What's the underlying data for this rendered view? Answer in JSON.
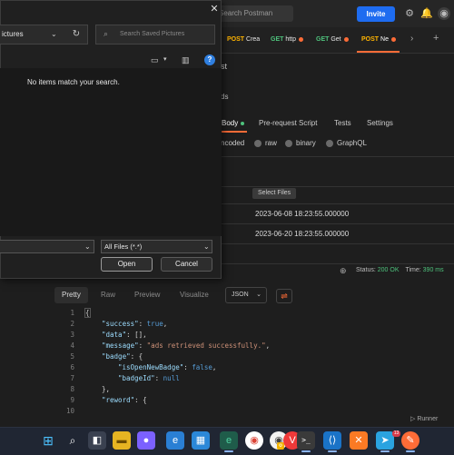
{
  "postman": {
    "search_placeholder": "Search Postman",
    "invite_label": "Invite",
    "tabs": [
      {
        "method": "POST",
        "name": "Crea"
      },
      {
        "method": "GET",
        "name": "http"
      },
      {
        "method": "GET",
        "name": "Get"
      },
      {
        "method": "POST",
        "name": "Ne"
      }
    ],
    "request_title_fragment": "st",
    "section_fragment": "ds",
    "subtabs": [
      "Body",
      "Pre-request Script",
      "Tests",
      "Settings"
    ],
    "body_types": [
      "ncoded",
      "raw",
      "binary",
      "GraphQL"
    ],
    "select_files_label": "Select Files",
    "dates": [
      "2023-06-08 18:23:55.000000",
      "2023-06-20 18:23:55.000000"
    ],
    "status_label": "Status:",
    "status_value": "200 OK",
    "time_label": "Time:",
    "time_value": "390 ms",
    "response_tabs": [
      "Pretty",
      "Raw",
      "Preview",
      "Visualize"
    ],
    "format_select": "JSON",
    "runner_label": "Runner",
    "code_line_numbers": [
      "1",
      "2",
      "3",
      "4",
      "5",
      "6",
      "7",
      "8",
      "9",
      "10"
    ],
    "code_lines": {
      "l1": "{",
      "l2_key": "\"success\"",
      "l2_rest": ": ",
      "l2_val": "true",
      "l2_end": ",",
      "l3_key": "\"data\"",
      "l3_rest": ": [],",
      "l4_key": "\"message\"",
      "l4_rest": ": ",
      "l4_val": "\"ads retrieved successfully.\"",
      "l4_end": ",",
      "l5_key": "\"badge\"",
      "l5_rest": ": {",
      "l6_key": "\"isOpenNewBadge\"",
      "l6_rest": ": ",
      "l6_val": "false",
      "l6_end": ",",
      "l7_key": "\"badgeId\"",
      "l7_rest": ": ",
      "l7_val": "null",
      "l8": "},",
      "l9_key": "\"reword\"",
      "l9_rest": ": {"
    },
    "accent_color": "#ff6c37"
  },
  "dialog": {
    "address_fragment": "ictures",
    "search_placeholder": "Search Saved Pictures",
    "empty_message": "No items match your search.",
    "file_type": "All Files (*.*)",
    "open_label": "Open",
    "cancel_label": "Cancel",
    "close_glyph": "✕"
  },
  "taskbar": {
    "icons": [
      "windows-start-icon",
      "search-icon",
      "file-explorer-icon",
      "chat-icon",
      "edge-icon",
      "store-icon",
      "edge-dev-icon",
      "chrome-icon",
      "chrome-dev-icon",
      "vivaldi-icon",
      "terminal-icon",
      "vscode-icon",
      "xampp-icon",
      "telegram-icon",
      "postman-icon"
    ],
    "telegram_badge": "13"
  }
}
